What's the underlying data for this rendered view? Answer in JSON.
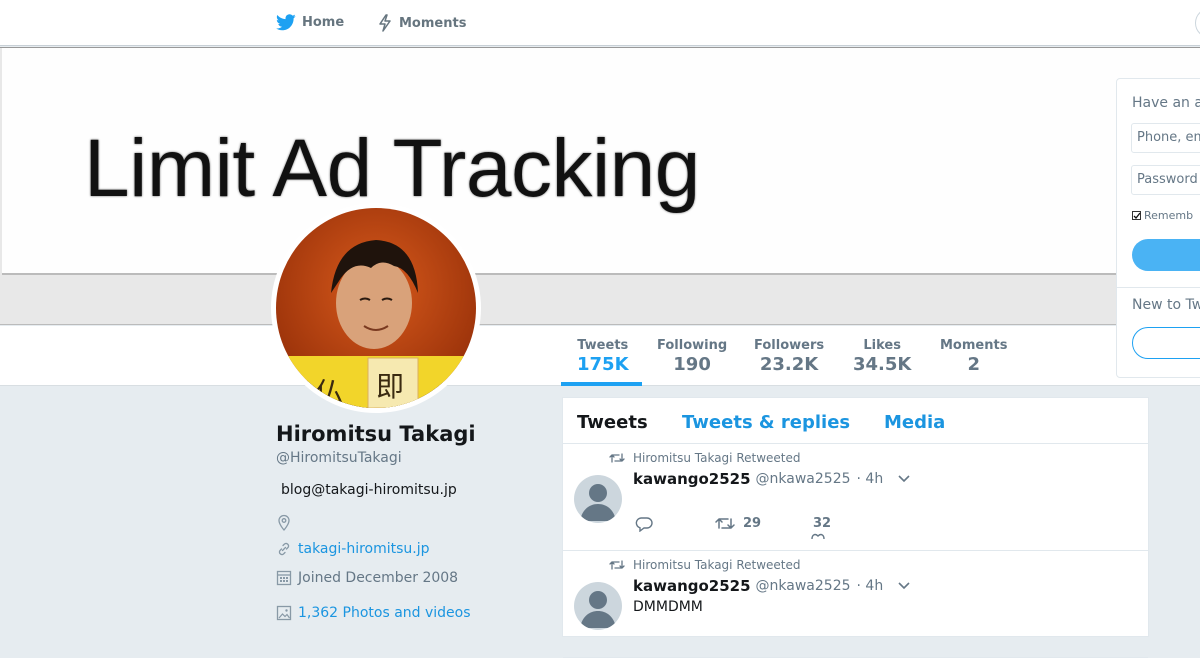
{
  "nav": {
    "home_label": "Home",
    "moments_label": "Moments"
  },
  "banner": {
    "text": "Limit Ad Tracking"
  },
  "stats": {
    "tweets_label": "Tweets",
    "tweets_value": "175K",
    "following_label": "Following",
    "following_value": "190",
    "followers_label": "Followers",
    "followers_value": "23.2K",
    "likes_label": "Likes",
    "likes_value": "34.5K",
    "moments_label": "Moments",
    "moments_value": "2"
  },
  "profile": {
    "name": "Hiromitsu Takagi",
    "handle": "@HiromitsuTakagi",
    "bio": "blog@takagi-hiromitsu.jp",
    "website": "takagi-hiromitsu.jp",
    "joined": "Joined December 2008",
    "photos": "1,362 Photos and videos"
  },
  "timeline": {
    "tabs": [
      "Tweets",
      "Tweets & replies",
      "Media"
    ],
    "tweets": [
      {
        "retweet_line": "Hiromitsu Takagi Retweeted",
        "name": "kawango2525",
        "handle": "@nkawa2525",
        "time": "· 4h",
        "body": "",
        "retweets": "29",
        "likes": "32"
      },
      {
        "retweet_line": "Hiromitsu Takagi Retweeted",
        "name": "kawango2525",
        "handle": "@nkawa2525",
        "time": "· 4h",
        "body": "DMMDMM"
      }
    ]
  },
  "login": {
    "title": "Have an a",
    "phone_placeholder": "Phone, em",
    "password_placeholder": "Password",
    "remember_label": "Rememb",
    "new_to": "New to Tw"
  },
  "colors": {
    "accent": "#1da1f2",
    "link": "#1b95e0",
    "background": "#e6ecf0"
  }
}
